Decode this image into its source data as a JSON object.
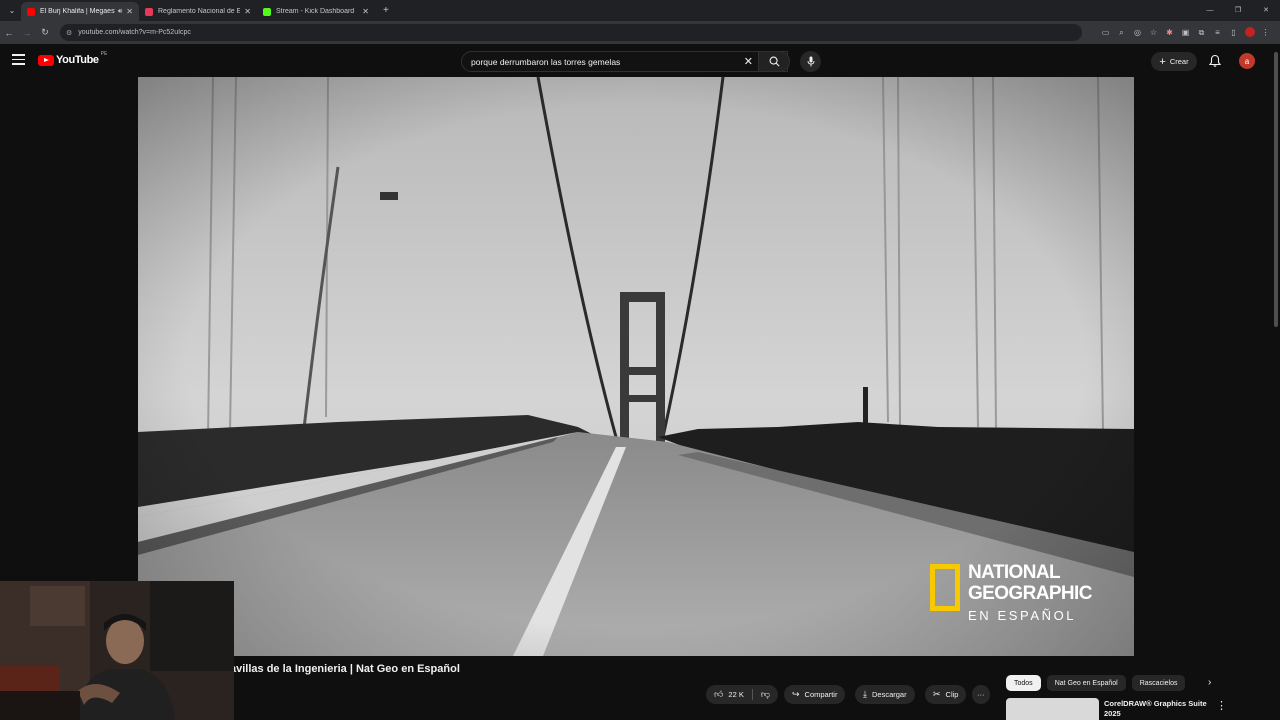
{
  "browser": {
    "tabs": [
      {
        "title": "El Burj Khalifa | Megaestructuras",
        "active": true,
        "audio": true,
        "favicon_color": "#ff0000"
      },
      {
        "title": "Reglamento Nacional de Edificaciones",
        "active": false,
        "favicon_color": "#e8395a"
      },
      {
        "title": "Stream - Kick Dashboard",
        "active": false,
        "favicon_color": "#53fc18"
      }
    ],
    "url": "youtube.com/watch?v=m-Pc52uIcpc"
  },
  "youtube": {
    "logo_text": "YouTube",
    "region": "PE",
    "search_query": "porque derrumbaron las torres gemelas",
    "create_label": "Crear",
    "avatar_letter": "a"
  },
  "video": {
    "watermark": {
      "line1": "NATIONAL",
      "line2": "GEOGRAPHIC",
      "line3": "EN ESPAÑOL"
    },
    "title": "avillas de la Ingenieria | Nat Geo en Español"
  },
  "actions": {
    "likes": "22 K",
    "share": "Compartir",
    "download": "Descargar",
    "clip": "Clip",
    "more": "···"
  },
  "chips": [
    "Todos",
    "Nat Geo en Español",
    "Rascacielos"
  ],
  "recommended": {
    "title": "CorelDRAW® Graphics Suite 2025"
  },
  "colors": {
    "bg": "#0f0f0f",
    "youtube_red": "#ff0000",
    "natgeo_yellow": "#f7c900"
  }
}
